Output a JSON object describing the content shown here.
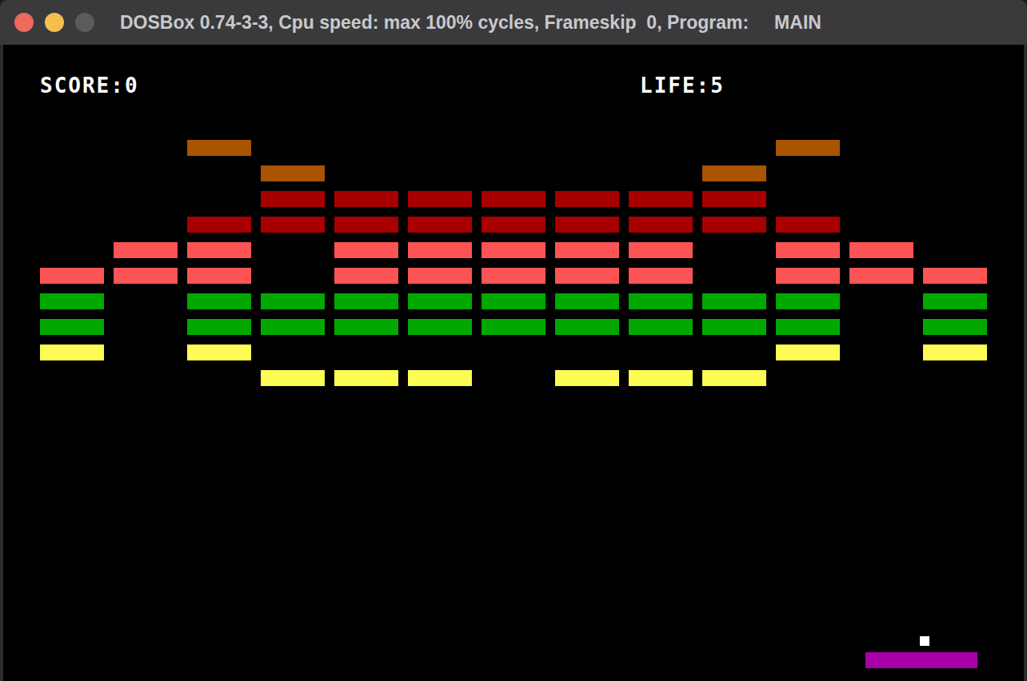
{
  "window": {
    "title": "DOSBox 0.74-3-3, Cpu speed: max 100% cycles, Frameskip  0, Program:     MAIN"
  },
  "hud": {
    "score": "SCORE:0",
    "lives": "LIFE:5"
  },
  "bricks": [
    {
      "color": "#a85400",
      "cells": [
        false,
        false,
        true,
        false,
        false,
        false,
        false,
        false,
        false,
        false,
        true,
        false,
        false
      ]
    },
    {
      "color": "#a85400",
      "cells": [
        false,
        false,
        false,
        true,
        false,
        false,
        false,
        false,
        false,
        true,
        false,
        false,
        false
      ]
    },
    {
      "color": "#a80000",
      "cells": [
        false,
        false,
        false,
        true,
        true,
        true,
        true,
        true,
        true,
        true,
        false,
        false,
        false
      ]
    },
    {
      "color": "#a80000",
      "cells": [
        false,
        false,
        true,
        true,
        true,
        true,
        true,
        true,
        true,
        true,
        true,
        false,
        false
      ]
    },
    {
      "color": "#fc5454",
      "cells": [
        false,
        true,
        true,
        false,
        true,
        true,
        true,
        true,
        true,
        false,
        true,
        true,
        false
      ]
    },
    {
      "color": "#fc5454",
      "cells": [
        true,
        true,
        true,
        false,
        true,
        true,
        true,
        true,
        true,
        false,
        true,
        true,
        true
      ]
    },
    {
      "color": "#00a800",
      "cells": [
        true,
        false,
        true,
        true,
        true,
        true,
        true,
        true,
        true,
        true,
        true,
        false,
        true
      ]
    },
    {
      "color": "#00a800",
      "cells": [
        true,
        false,
        true,
        true,
        true,
        true,
        true,
        true,
        true,
        true,
        true,
        false,
        true
      ]
    },
    {
      "color": "#fcfc54",
      "cells": [
        true,
        false,
        true,
        false,
        false,
        false,
        false,
        false,
        false,
        false,
        true,
        false,
        true
      ]
    },
    {
      "color": "#fcfc54",
      "cells": [
        false,
        false,
        false,
        true,
        true,
        true,
        false,
        true,
        true,
        true,
        false,
        false,
        false
      ]
    }
  ]
}
